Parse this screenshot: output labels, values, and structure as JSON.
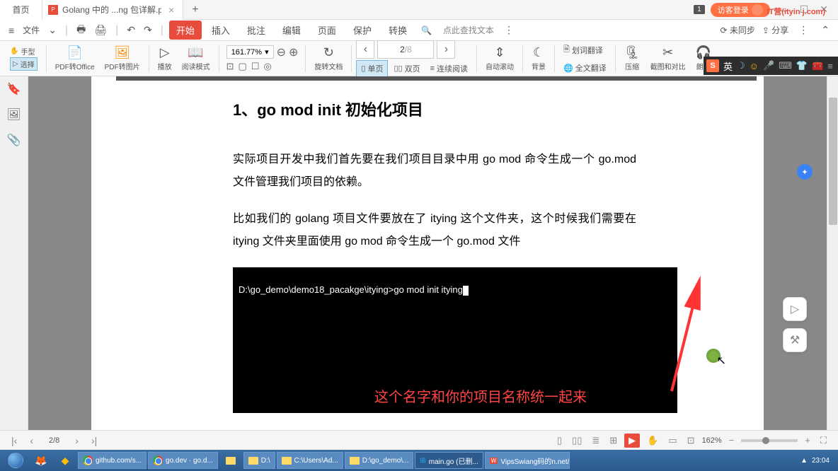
{
  "titlebar": {
    "home": "首页",
    "tab_title": "Golang 中的 ...ng 包详解.pdf",
    "badge": "1",
    "login": "访客登录",
    "watermark": "IT营(ityin j.com)"
  },
  "menubar": {
    "file": "文件",
    "tabs": [
      "开始",
      "插入",
      "批注",
      "编辑",
      "页面",
      "保护",
      "转换"
    ],
    "active_tab": 0,
    "search_icon": "🔍",
    "search": "点此查找文本",
    "sync": "未同步",
    "share": "分享"
  },
  "toolbar": {
    "hand": "手型",
    "select": "选择",
    "pdf_office": "PDF转Office",
    "pdf_image": "PDF转图片",
    "play": "播放",
    "read_mode": "阅读模式",
    "zoom": "161.77%",
    "rotate": "旋转文档",
    "single": "单页",
    "double": "双页",
    "continuous": "连续阅读",
    "auto_scroll": "自动滚动",
    "background": "背景",
    "translate": "划词翻译",
    "full_translate": "全文翻译",
    "compress": "压缩",
    "crop_compare": "截图和对比",
    "read_aloud": "朗读",
    "page_current": "2",
    "page_total": "/8"
  },
  "document": {
    "heading": "1、go mod init  初始化项目",
    "para1": "实际项目开发中我们首先要在我们项目目录中用 go mod 命令生成一个 go.mod 文件管理我们项目的依赖。",
    "para2": "比如我们的 golang 项目文件要放在了 itying 这个文件夹，这个时候我们需要在 itying 文件夹里面使用 go mod 命令生成一个 go.mod 文件",
    "terminal_prompt": "D:\\go_demo\\demo18_pacakge\\itying>go mod init itying",
    "terminal_annotation": "这个名字和你的项目名称统一起来"
  },
  "statusbar": {
    "page": "2/8",
    "zoom": "162%"
  },
  "taskbar": {
    "items": [
      {
        "icon": "chrome",
        "label": "github.com/s..."
      },
      {
        "icon": "chrome",
        "label": "go.dev · go.d..."
      },
      {
        "icon": "folder",
        "label": "D:\\"
      },
      {
        "icon": "folder",
        "label": "C:\\Users\\Ad..."
      },
      {
        "icon": "folder",
        "label": "D:\\go_demo\\..."
      },
      {
        "icon": "vscode",
        "label": "main.go (已删..."
      },
      {
        "icon": "wps",
        "label": "VipsSwiang码的n.net/a开"
      }
    ],
    "time": "23:04"
  },
  "ime": {
    "lang": "英"
  }
}
